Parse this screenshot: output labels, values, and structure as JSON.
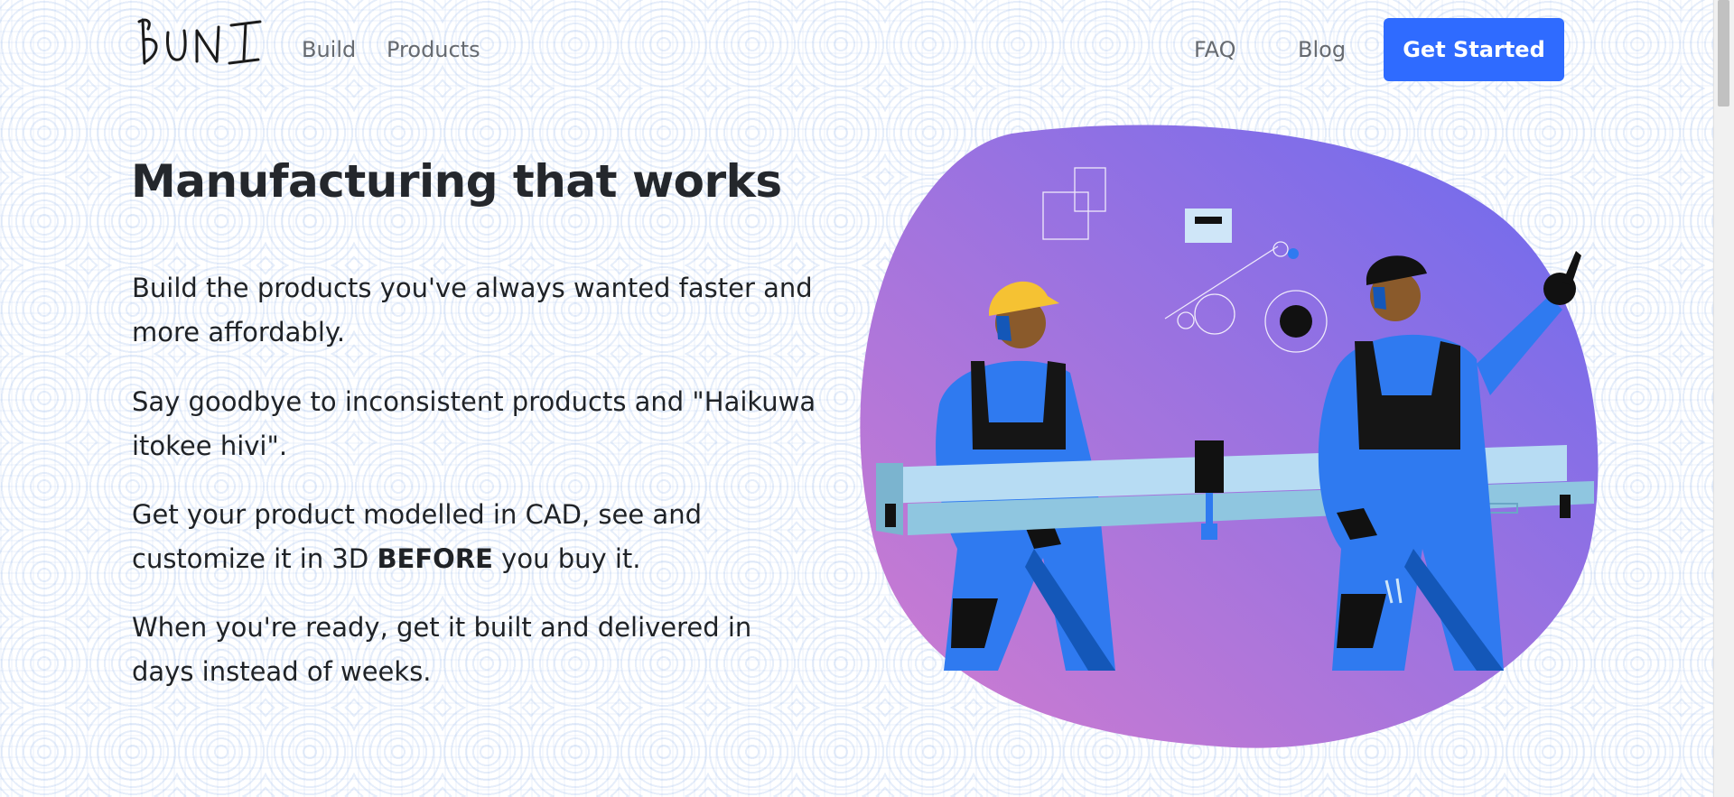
{
  "brand": {
    "logo_text": "BUNI"
  },
  "nav": {
    "build": "Build",
    "products": "Products",
    "faq": "FAQ",
    "blog": "Blog",
    "cta": "Get Started"
  },
  "hero": {
    "title": "Manufacturing that works",
    "p1": "Build the products you've always wanted faster and more affordably.",
    "p2": "Say goodbye to inconsistent products and \"Haikuwa itokee hivi\".",
    "p3_before": "Get your product modelled in CAD, see and customize it in 3D ",
    "p3_bold": "BEFORE",
    "p3_after": " you buy it.",
    "p4": "When you're ready, get it built and delivered in days instead of weeks."
  },
  "colors": {
    "accent": "#2f6bff",
    "blob_start": "#d27ccf",
    "blob_end": "#6b6aef",
    "uniform": "#2f7af0"
  },
  "icons": [
    "illustration-two-workers-carrying-beam"
  ]
}
